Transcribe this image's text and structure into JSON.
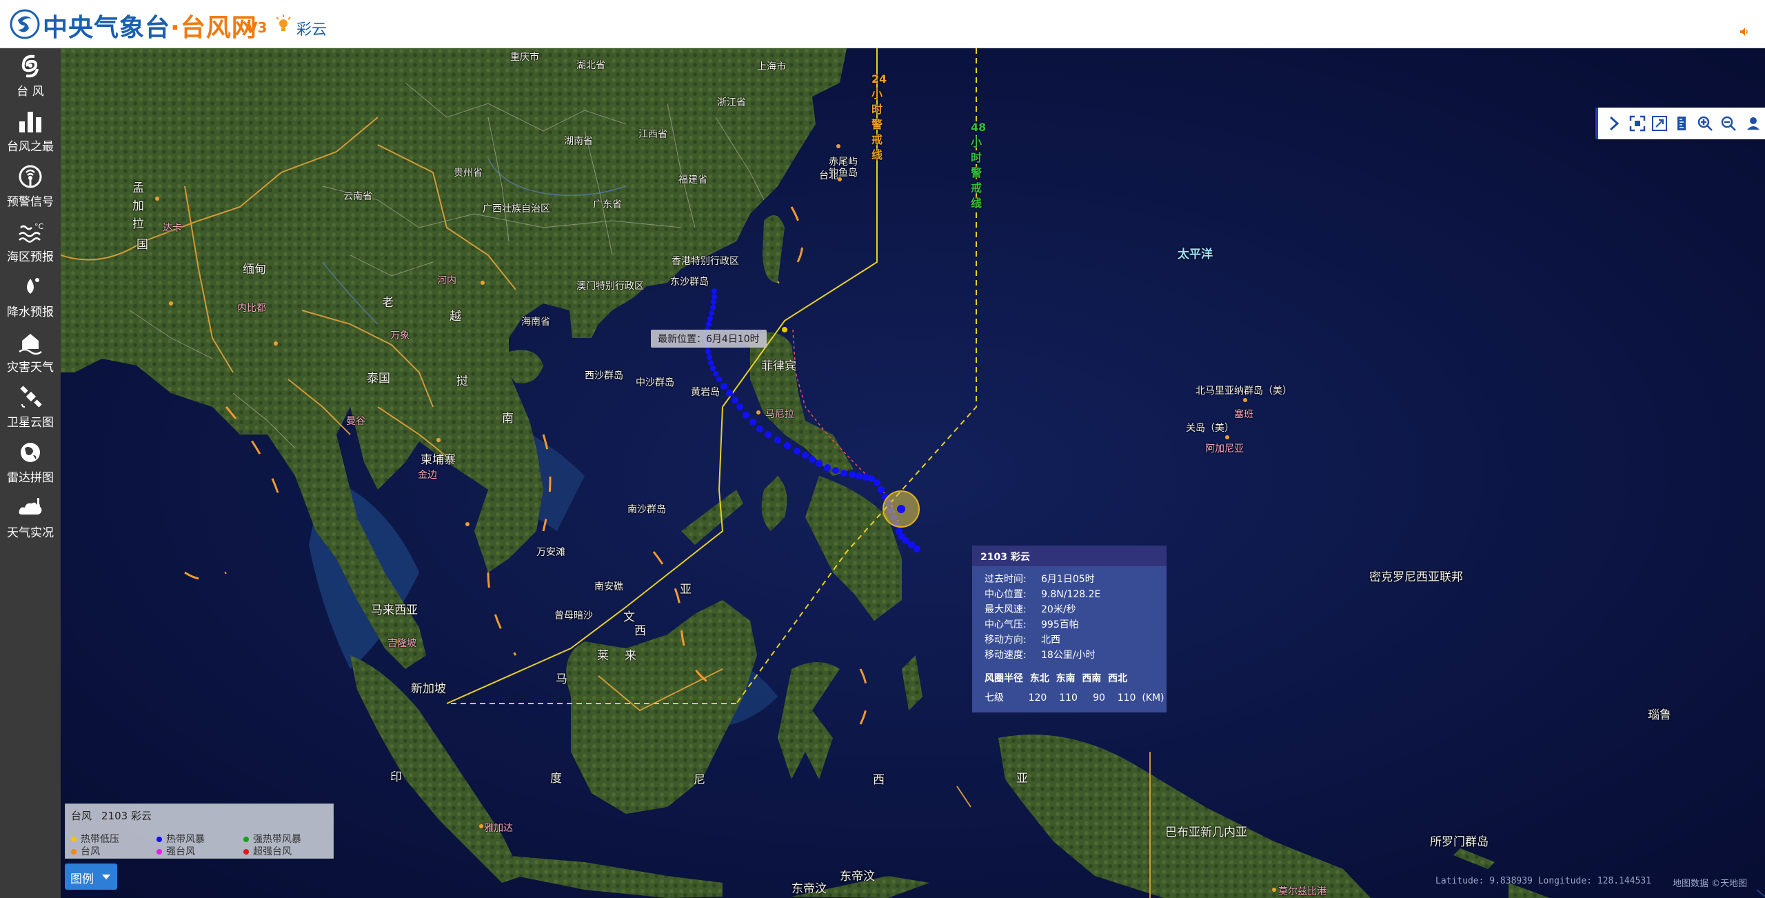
{
  "header": {
    "logo_text_main": "中央气象台",
    "logo_text_dot": "·",
    "logo_text_site": "台风网",
    "version": "V3",
    "current_typhoon": "彩云"
  },
  "sidebar": {
    "items": [
      {
        "label": "台 风",
        "icon": "typhoon-icon"
      },
      {
        "label": "台风之最",
        "icon": "bar-chart-icon"
      },
      {
        "label": "预警信号",
        "icon": "warning-signal-icon"
      },
      {
        "label": "海区预报",
        "icon": "sea-forecast-icon"
      },
      {
        "label": "降水预报",
        "icon": "rain-drop-icon"
      },
      {
        "label": "灾害天气",
        "icon": "house-hazard-icon"
      },
      {
        "label": "卫星云图",
        "icon": "satellite-icon"
      },
      {
        "label": "雷达拼图",
        "icon": "radar-icon"
      },
      {
        "label": "天气实况",
        "icon": "cloud-icon"
      }
    ]
  },
  "map": {
    "labels": {
      "chongqing": "重庆市",
      "hubei": "湖北省",
      "shanghai": "上海市",
      "zhejiang": "浙江省",
      "hunan": "湖南省",
      "jiangxi": "江西省",
      "guizhou": "贵州省",
      "fujian": "福建省",
      "yunnan": "云南省",
      "guangxi": "广西壮族自治区",
      "guangdong": "广东省",
      "diaoyu": "钓鱼岛",
      "chiwei": "赤尾屿",
      "hongkong": "香港特别行政区",
      "macau": "澳门特别行政区",
      "dongsha": "东沙群岛",
      "hainan": "海南省",
      "xisha": "西沙群岛",
      "zhongsha": "中沙群岛",
      "huangyan": "黄岩岛",
      "nansha": "南沙群岛",
      "wanan": "万安滩",
      "nanan": "南安礁",
      "zengmu": "曾母暗沙",
      "philippines": "菲律宾",
      "manila": "马尼拉",
      "pacific": "太平洋",
      "nmariana": "北马里亚纳群岛（美）",
      "saipan": "塞班",
      "guam": "关岛（美）",
      "agana": "阿加尼亚",
      "micronesia": "密克罗尼西亚联邦",
      "png": "巴布亚新几内亚",
      "solomon": "所罗门群岛",
      "nauru": "瑙鲁",
      "dongdiwen": "东帝汶",
      "dongdiwen2": "东帝汶",
      "singapore": "新加坡",
      "malaysia": "马来西亚",
      "kualalumpur": "吉隆坡",
      "cambodia": "柬埔寨",
      "phnompenh": "金边",
      "laos": "老",
      "wo": "挝",
      "vientiane": "万象",
      "thailand_tai": "泰国",
      "bangkok": "曼谷",
      "vietnam_yue": "越",
      "vietnam_nan": "南",
      "hanoi": "河内",
      "myanmar": "缅甸",
      "naypyidaw": "内比都",
      "bangla1": "孟",
      "bangla2": "加",
      "bangla3": "拉",
      "bangla4": "国",
      "dhaka": "达卡",
      "indo1": "印",
      "indo2": "度",
      "indo3": "尼",
      "indo4": "西",
      "indo5": "亚",
      "borneo1": "文",
      "borneo2": "莱",
      "borneo3": "马",
      "borneo4": "来",
      "borneo5": "西",
      "borneo6": "亚",
      "jakarta": "雅加达",
      "port_moresby": "莫尔兹比港",
      "taipei": "台北",
      "line24": "24小时警戒线",
      "line48": "48小时警戒线"
    }
  },
  "latest_position": "最新位置：6月4日10时",
  "info_popup": {
    "title": "2103 彩云",
    "rows": [
      {
        "k": "过去时间:",
        "v": "6月1日05时"
      },
      {
        "k": "中心位置:",
        "v": "9.8N/128.2E"
      },
      {
        "k": "最大风速:",
        "v": "20米/秒"
      },
      {
        "k": "中心气压:",
        "v": "995百帕"
      },
      {
        "k": "移动方向:",
        "v": "北西"
      },
      {
        "k": "移动速度:",
        "v": "18公里/小时"
      }
    ],
    "wind_header": "风圈半径  东北  东南  西南  西北",
    "wind_row": "七级        120    110     90    110  (KM)"
  },
  "legend": {
    "title_a": "台风",
    "title_b": "2103 彩云",
    "items": [
      {
        "label": "热带低压",
        "color": "#f2c500"
      },
      {
        "label": "热带风暴",
        "color": "#1010ff"
      },
      {
        "label": "强热带风暴",
        "color": "#18a018"
      },
      {
        "label": "台风",
        "color": "#f08a10"
      },
      {
        "label": "强台风",
        "color": "#e020e0"
      },
      {
        "label": "超强台风",
        "color": "#e01818"
      }
    ],
    "button_label": "图例"
  },
  "footer": {
    "coords": "Latitude: 9.838939 Longitude: 128.144531",
    "attribution": "地图数据 ©天地图"
  },
  "colors": {
    "brand_blue": "#1a5fb0",
    "brand_orange": "#f07a10",
    "track_blue": "#1010ff",
    "warning_24": "#e8d020",
    "warning_48": "#e8d020"
  }
}
